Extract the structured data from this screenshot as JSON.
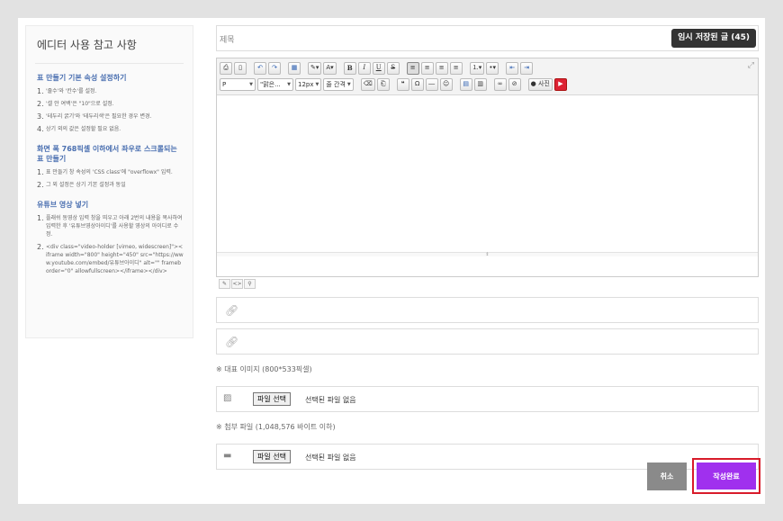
{
  "guide": {
    "title": "에디터 사용 참고 사항",
    "sections": [
      {
        "heading": "표 만들기 기본 속성 설정하기",
        "items": [
          "'줄수'와 '칸수'를 설정.",
          "'셀 안 여백'은 \"10\"으로 설정.",
          "'테두리 굵기'와 '테두리색'은 필요한 경우 변경.",
          "상기 외의 값은 설정할 필요 없음."
        ]
      },
      {
        "heading": "화면 폭 768픽셀 이하에서 좌우로 스크롤되는 표 만들기",
        "items": [
          "표 만들기 창 속성의 'CSS class'에 \"overflowx\" 입력.",
          "그 외 설정은 상기 기본 설정과 동일"
        ]
      },
      {
        "heading": "유튜브 영상 넣기",
        "items": [
          "플래쉬 동영상 입력 창을 띄우고 아래 2번의 내용을 복사하여 입력한 후 '유튜브영상아이디'를 사용할 영상의 아이디로 수정.",
          "<div class=\"video-holder [vimeo, widescreen]\"><iframe width=\"800\" height=\"450\" src=\"https://www.youtube.com/embed/유튜브아이디\" alt=\"\" frameborder=\"0\" allowfullscreen></iframe></div>"
        ]
      }
    ]
  },
  "form": {
    "title_placeholder": "제목",
    "draft_button": "임시 저장된 글 (45)",
    "toolbar": {
      "format_select": "P",
      "font_select": "\"맑은...",
      "size_select": "12px",
      "line_select": "줄 간격",
      "photo_button": "사진"
    },
    "image_note": "※ 대표 이미지 (800*533픽셀)",
    "image_file_button": "파일 선택",
    "image_file_text": "선택된 파일 없음",
    "attach_note": "※ 첨부 파일 (1,048,576 바이트 이하)",
    "attach_file_button": "파일 선택",
    "attach_file_text": "선택된 파일 없음",
    "cancel_button": "취소",
    "submit_button": "작성완료"
  }
}
